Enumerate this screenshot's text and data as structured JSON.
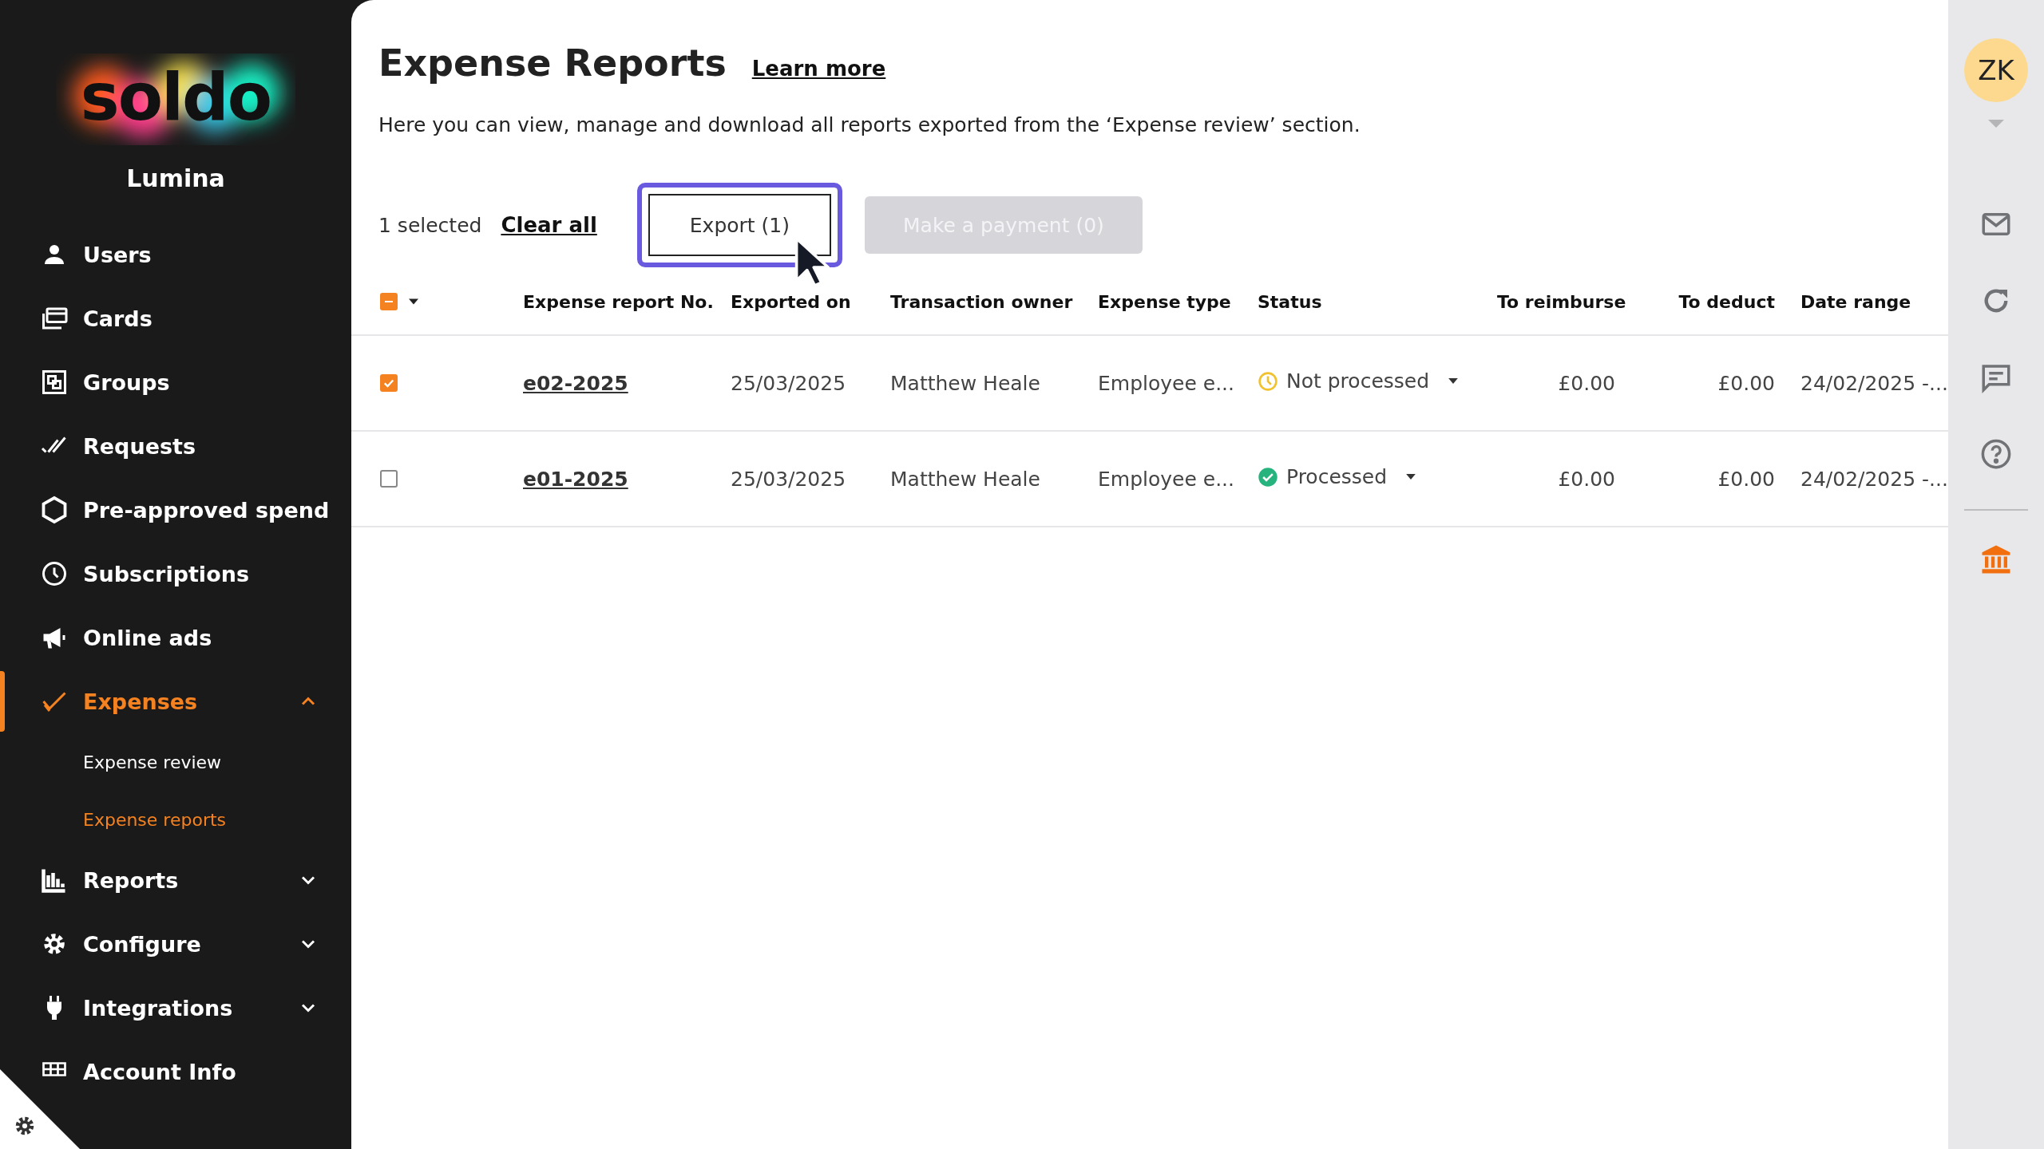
{
  "sidebar": {
    "logo": "soldo",
    "company": "Lumina",
    "items": [
      {
        "label": "Users",
        "selected": false
      },
      {
        "label": "Cards",
        "selected": false
      },
      {
        "label": "Groups",
        "selected": false
      },
      {
        "label": "Requests",
        "selected": false
      },
      {
        "label": "Pre-approved spend",
        "selected": false
      },
      {
        "label": "Subscriptions",
        "selected": false
      },
      {
        "label": "Online ads",
        "selected": false
      },
      {
        "label": "Expenses",
        "selected": true,
        "expanded": true,
        "children": [
          {
            "label": "Expense review",
            "selected": false
          },
          {
            "label": "Expense reports",
            "selected": true
          }
        ]
      },
      {
        "label": "Reports",
        "selected": false,
        "expanded": false
      },
      {
        "label": "Configure",
        "selected": false,
        "expanded": false
      },
      {
        "label": "Integrations",
        "selected": false,
        "expanded": false
      },
      {
        "label": "Account Info",
        "selected": false
      }
    ]
  },
  "page": {
    "title": "Expense Reports",
    "learn_more": "Learn more",
    "description": "Here you can view, manage and download all reports exported from the ‘Expense review’ section."
  },
  "toolbar": {
    "selection": "1 selected",
    "clear": "Clear all",
    "export": {
      "label": "Export (1)",
      "focused": true,
      "disabled": false
    },
    "payment": {
      "label": "Make a payment (0)",
      "disabled": true
    }
  },
  "table": {
    "select_all": {
      "indeterminate": true
    },
    "columns": [
      "Expense report No.",
      "Exported on",
      "Transaction owner",
      "Expense type",
      "Status",
      "To reimburse",
      "To deduct",
      "Date range"
    ],
    "rows": [
      {
        "selected": true,
        "report_no": "e02-2025",
        "exported_on": "25/03/2025",
        "owner": "Matthew Heale",
        "type": "Employee e...",
        "status": {
          "label": "Not processed",
          "kind": "pending"
        },
        "to_reimburse": "£0.00",
        "to_deduct": "£0.00",
        "date_range": "24/02/2025 -..."
      },
      {
        "selected": false,
        "report_no": "e01-2025",
        "exported_on": "25/03/2025",
        "owner": "Matthew Heale",
        "type": "Employee e...",
        "status": {
          "label": "Processed",
          "kind": "done"
        },
        "to_reimburse": "£0.00",
        "to_deduct": "£0.00",
        "date_range": "24/02/2025 -..."
      }
    ]
  },
  "user": {
    "initials": "ZK"
  }
}
